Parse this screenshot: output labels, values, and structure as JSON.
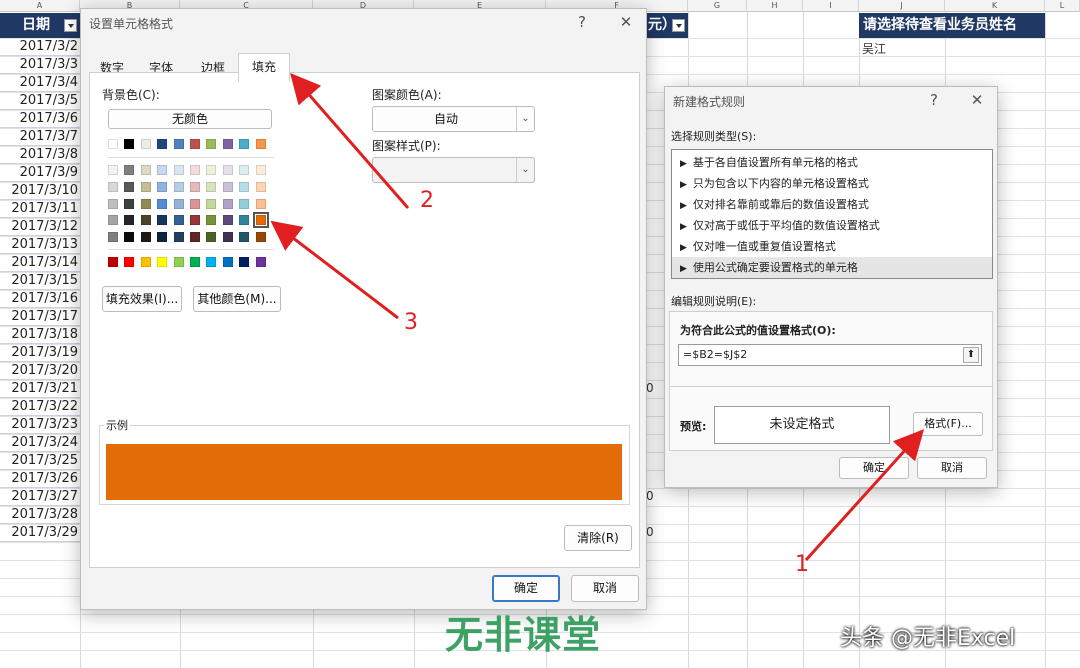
{
  "sheet": {
    "column_letters": [
      "A",
      "B",
      "C",
      "D",
      "E",
      "F",
      "G",
      "H",
      "I",
      "J",
      "K",
      "L"
    ],
    "header_date": "日期",
    "header_amount_fragment": "元）",
    "header_select": "请选择待查看业务员姓名",
    "selected_name": "吴江",
    "dates": [
      "2017/3/2",
      "2017/3/3",
      "2017/3/4",
      "2017/3/5",
      "2017/3/6",
      "2017/3/7",
      "2017/3/8",
      "2017/3/9",
      "2017/3/10",
      "2017/3/11",
      "2017/3/12",
      "2017/3/13",
      "2017/3/14",
      "2017/3/15",
      "2017/3/16",
      "2017/3/17",
      "2017/3/18",
      "2017/3/19",
      "2017/3/20",
      "2017/3/21",
      "2017/3/22",
      "2017/3/23",
      "2017/3/24",
      "2017/3/25",
      "2017/3/26",
      "2017/3/27",
      "2017/3/28",
      "2017/3/29"
    ],
    "zero_fragment": "0"
  },
  "format_cells_dialog": {
    "title": "设置单元格格式",
    "help": "?",
    "close": "✕",
    "tabs": [
      "数字",
      "字体",
      "边框",
      "填充"
    ],
    "active_tab": "填充",
    "bg_color_label": "背景色(C):",
    "no_color_button": "无颜色",
    "pattern_color_label": "图案颜色(A):",
    "pattern_color_value": "自动",
    "pattern_style_label": "图案样式(P):",
    "fill_effects_button": "填充效果(I)...",
    "more_colors_button": "其他颜色(M)...",
    "sample_label": "示例",
    "sample_color": "#e36c09",
    "clear_button": "清除(R)",
    "ok_button": "确定",
    "cancel_button": "取消",
    "theme_top_row": [
      "#ffffff",
      "#000000",
      "#eeece1",
      "#1f497d",
      "#4f81bd",
      "#c0504d",
      "#9bbb59",
      "#8064a2",
      "#4bacc6",
      "#f79646"
    ],
    "theme_shades": [
      [
        "#f2f2f2",
        "#7f7f7f",
        "#ddd9c3",
        "#c6d9f0",
        "#dbe5f1",
        "#f2dcdb",
        "#ebf1dd",
        "#e5e0ec",
        "#dbeef3",
        "#fdeada"
      ],
      [
        "#d8d8d8",
        "#595959",
        "#c4bd97",
        "#8db3e2",
        "#b8cce4",
        "#e5b9b7",
        "#d7e3bc",
        "#ccc1d9",
        "#b7dde8",
        "#fbd5b5"
      ],
      [
        "#bfbfbf",
        "#3f3f3f",
        "#938953",
        "#548dd4",
        "#95b3d7",
        "#d99694",
        "#c3d69b",
        "#b2a2c7",
        "#92cddc",
        "#fac08f"
      ],
      [
        "#a5a5a5",
        "#262626",
        "#494429",
        "#17365d",
        "#366092",
        "#953734",
        "#76923c",
        "#5f497a",
        "#31859b",
        "#e36c09"
      ],
      [
        "#7f7f7f",
        "#0c0c0c",
        "#1d1b10",
        "#0f243e",
        "#244061",
        "#632423",
        "#4f6128",
        "#3f3151",
        "#205867",
        "#974806"
      ]
    ],
    "standard_colors": [
      "#c00000",
      "#ff0000",
      "#ffc000",
      "#ffff00",
      "#92d050",
      "#00b050",
      "#00b0f0",
      "#0070c0",
      "#002060",
      "#7030a0"
    ]
  },
  "new_rule_dialog": {
    "title": "新建格式规则",
    "help": "?",
    "close": "✕",
    "select_type_label": "选择规则类型(S):",
    "rule_types": [
      "基于各自值设置所有单元格的格式",
      "只为包含以下内容的单元格设置格式",
      "仅对排名靠前或靠后的数值设置格式",
      "仅对高于或低于平均值的数值设置格式",
      "仅对唯一值或重复值设置格式",
      "使用公式确定要设置格式的单元格"
    ],
    "selected_rule_index": 5,
    "edit_desc_label": "编辑规则说明(E):",
    "formula_label": "为符合此公式的值设置格式(O):",
    "formula_value": "=$B2=$J$2",
    "preview_label": "预览:",
    "preview_text": "未设定格式",
    "format_button": "格式(F)...",
    "ok_button": "确定",
    "cancel_button": "取消"
  },
  "annotations": {
    "arrow_labels": [
      "1",
      "2",
      "3"
    ],
    "arrow_color": "#e02020"
  },
  "watermarks": {
    "logo_text": "无非课堂",
    "source_text": "头条 @无非Excel"
  }
}
